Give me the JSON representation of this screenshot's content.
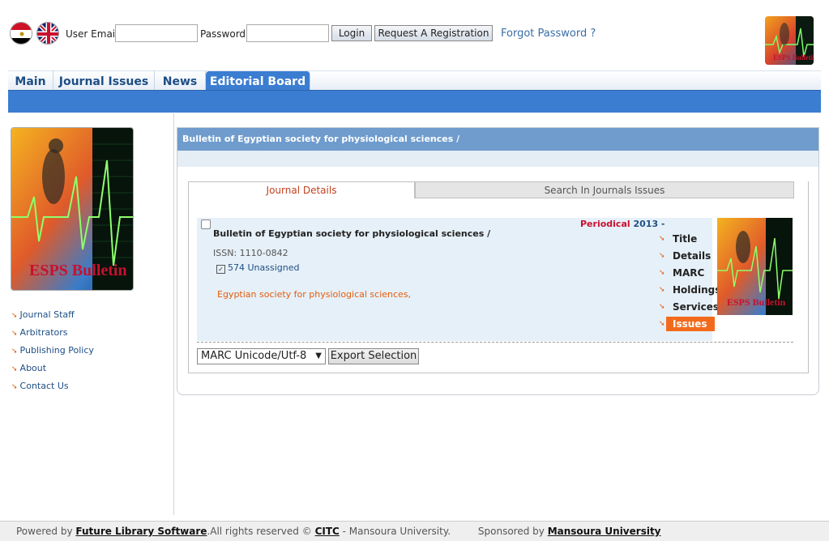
{
  "top": {
    "flag_eg": "egypt-flag",
    "flag_uk": "uk-flag",
    "email_label": "User Email :",
    "email_value": "",
    "password_label": "Password :",
    "password_value": "",
    "login_label": "Login",
    "register_label": "Request A Registration",
    "forgot_label": "Forgot Password ?"
  },
  "nav": {
    "tabs": [
      {
        "label": "Main"
      },
      {
        "label": "Journal Issues"
      },
      {
        "label": "News"
      },
      {
        "label": "Editorial Board"
      }
    ]
  },
  "sidebar": {
    "logo_text": "ESPS Bulletin",
    "items": [
      {
        "label": "Journal Staff"
      },
      {
        "label": "Arbitrators"
      },
      {
        "label": "Publishing Policy"
      },
      {
        "label": "About"
      },
      {
        "label": "Contact Us"
      }
    ]
  },
  "main": {
    "heading": "Bulletin of Egyptian society for physiological sciences /",
    "tabs": [
      {
        "label": "Journal Details"
      },
      {
        "label": "Search In Journals Issues"
      }
    ],
    "record": {
      "title": "Bulletin of Egyptian society for physiological sciences /",
      "issn": "ISSN: 1110-0842",
      "classification": "574 Unassigned",
      "author": "Egyptian society for physiological sciences,",
      "type": "Periodical",
      "year": "2013 -"
    },
    "menu": [
      {
        "label": "Title"
      },
      {
        "label": "Details"
      },
      {
        "label": "MARC"
      },
      {
        "label": "Holdings"
      },
      {
        "label": "Services"
      },
      {
        "label": "Issues"
      }
    ],
    "export_format": "MARC Unicode/Utf-8",
    "export_label": "Export Selection"
  },
  "footer": {
    "powered_prefix": "Powered by",
    "software": "Future Library Software",
    "rights": ".All rights reserved ©",
    "citc": "CITC",
    "mansoura": "- Mansoura University.",
    "sponsored_prefix": "Sponsored by",
    "sponsor": "Mansoura University"
  },
  "colors": {
    "accent": "#3b7dd1",
    "link": "#1e4e85",
    "orange": "#f26b1d"
  }
}
